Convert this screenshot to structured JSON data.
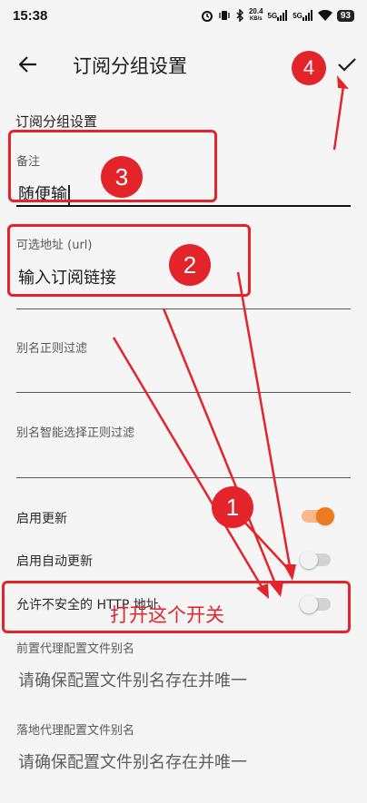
{
  "status_bar": {
    "time": "15:38",
    "net_speed_top": "20.4",
    "net_speed_unit": "KB/s",
    "sim1": "5G",
    "sim2": "5G",
    "battery": "93"
  },
  "header": {
    "title": "订阅分组设置"
  },
  "form": {
    "section_title": "订阅分组设置",
    "remark": {
      "label": "备注",
      "value": "随便输"
    },
    "url": {
      "label": "可选地址 (url)",
      "value": "输入订阅链接"
    },
    "alias_regex": {
      "label": "别名正则过滤"
    },
    "alias_smart_regex": {
      "label": "别名智能选择正则过滤"
    },
    "toggles": [
      {
        "label": "启用更新",
        "state": "on"
      },
      {
        "label": "启用自动更新",
        "state": "off"
      },
      {
        "label": "允许不安全的 HTTP 地址",
        "state": "off"
      }
    ],
    "prev_proxy": {
      "label": "前置代理配置文件别名",
      "placeholder": "请确保配置文件别名存在并唯一"
    },
    "landing_proxy": {
      "label": "落地代理配置文件别名",
      "placeholder": "请确保配置文件别名存在并唯一"
    }
  },
  "annotations": {
    "badge_1": "1",
    "badge_2": "2",
    "badge_3": "3",
    "badge_4": "4",
    "note": "打开这个开关",
    "accent_color": "#e3242b"
  },
  "colors": {
    "background": "#f6f5f5",
    "switch_on": "#ee7a1e"
  },
  "icons": {
    "back": "arrow-left-icon",
    "confirm": "check-icon"
  }
}
